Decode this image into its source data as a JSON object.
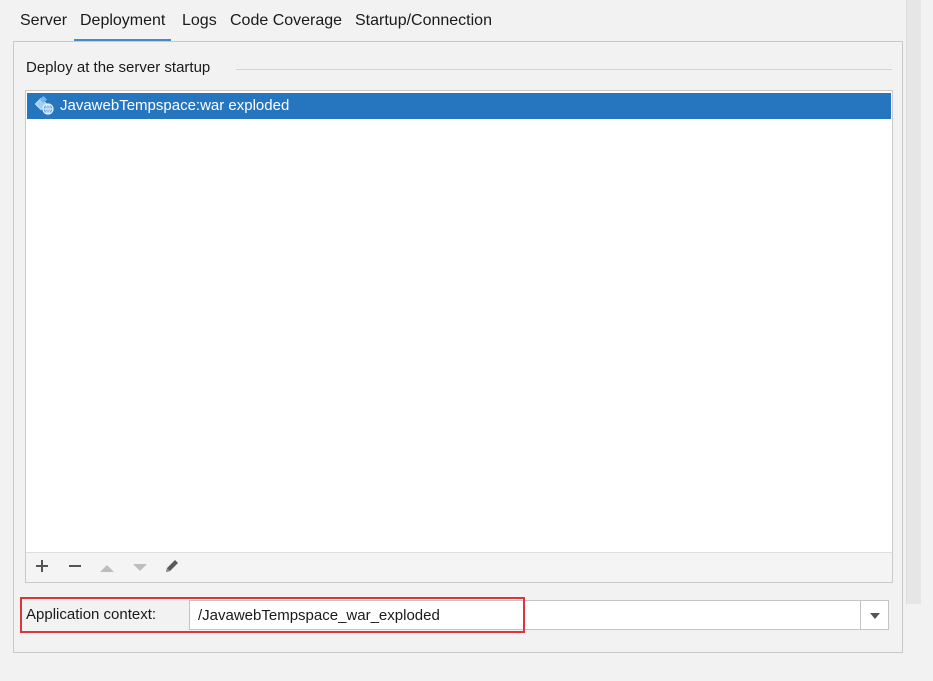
{
  "tabs": [
    {
      "label": "Server"
    },
    {
      "label": "Deployment",
      "active": true
    },
    {
      "label": "Logs"
    },
    {
      "label": "Code Coverage"
    },
    {
      "label": "Startup/Connection"
    }
  ],
  "deploy": {
    "group_title": "Deploy at the server startup",
    "items": [
      {
        "label": "JavawebTempspace:war exploded",
        "icon": "artifact-web-icon",
        "selected": true
      }
    ],
    "toolbar": [
      {
        "icon": "add-icon",
        "enabled": true
      },
      {
        "icon": "remove-icon",
        "enabled": true
      },
      {
        "icon": "move-up-icon",
        "enabled": false
      },
      {
        "icon": "move-down-icon",
        "enabled": false
      },
      {
        "icon": "edit-icon",
        "enabled": true
      }
    ]
  },
  "context": {
    "label": "Application context:",
    "value": "/JavawebTempspace_war_exploded"
  },
  "colors": {
    "selection": "#2675bf",
    "tab_underline": "#4a88c7",
    "highlight_box": "#e0343a"
  }
}
